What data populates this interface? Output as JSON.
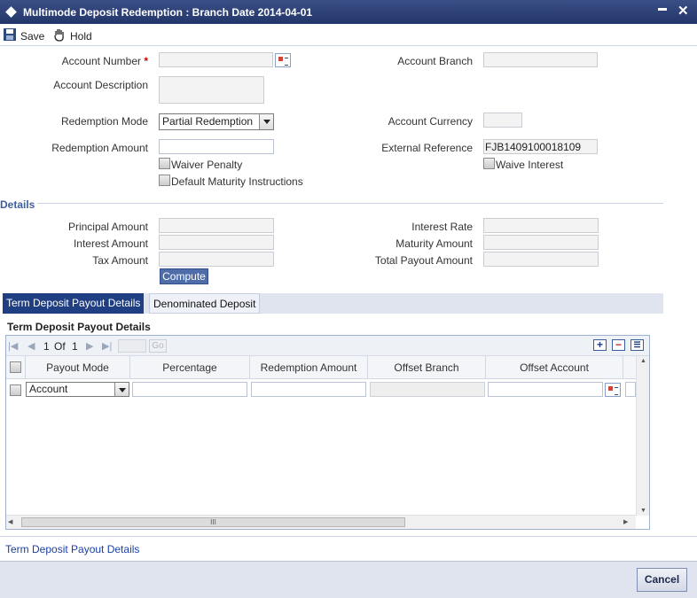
{
  "window": {
    "title": "Multimode Deposit Redemption : Branch Date 2014-04-01",
    "minimize": "▬",
    "close": "✕"
  },
  "toolbar": {
    "save_label": "Save",
    "hold_label": "Hold"
  },
  "form": {
    "account_number_label": "Account Number",
    "required_mark": "*",
    "account_branch_label": "Account Branch",
    "account_description_label": "Account Description",
    "redemption_mode_label": "Redemption Mode",
    "redemption_mode_value": "Partial Redemption",
    "account_currency_label": "Account Currency",
    "redemption_amount_label": "Redemption Amount",
    "external_reference_label": "External Reference",
    "external_reference_value": "FJB1409100018109",
    "waiver_penalty_label": "Waiver Penalty",
    "default_maturity_label": "Default Maturity Instructions",
    "waive_interest_label": "Waive Interest"
  },
  "details": {
    "section_label": "Details",
    "principal_amount_label": "Principal Amount",
    "interest_rate_label": "Interest Rate",
    "interest_amount_label": "Interest Amount",
    "maturity_amount_label": "Maturity Amount",
    "tax_amount_label": "Tax Amount",
    "total_payout_label": "Total Payout Amount",
    "compute_label": "Compute"
  },
  "tabs": [
    {
      "label": "Term Deposit Payout Details",
      "active": true
    },
    {
      "label": "Denominated Deposit",
      "active": false
    }
  ],
  "grid": {
    "title": "Term Deposit Payout Details",
    "pager": {
      "current": "1",
      "of_label": "Of",
      "total": "1",
      "go_label": "Go"
    },
    "columns": [
      "Payout Mode",
      "Percentage",
      "Redemption Amount",
      "Offset Branch",
      "Offset Account"
    ],
    "rows": [
      {
        "payout_mode": "Account"
      }
    ],
    "scroll_mark": "III"
  },
  "footer": {
    "link_label": "Term Deposit Payout Details",
    "cancel_label": "Cancel"
  },
  "colors": {
    "title_bar": "#2b3f77",
    "accent": "#4f6da8",
    "tab_active": "#1f3f82"
  }
}
